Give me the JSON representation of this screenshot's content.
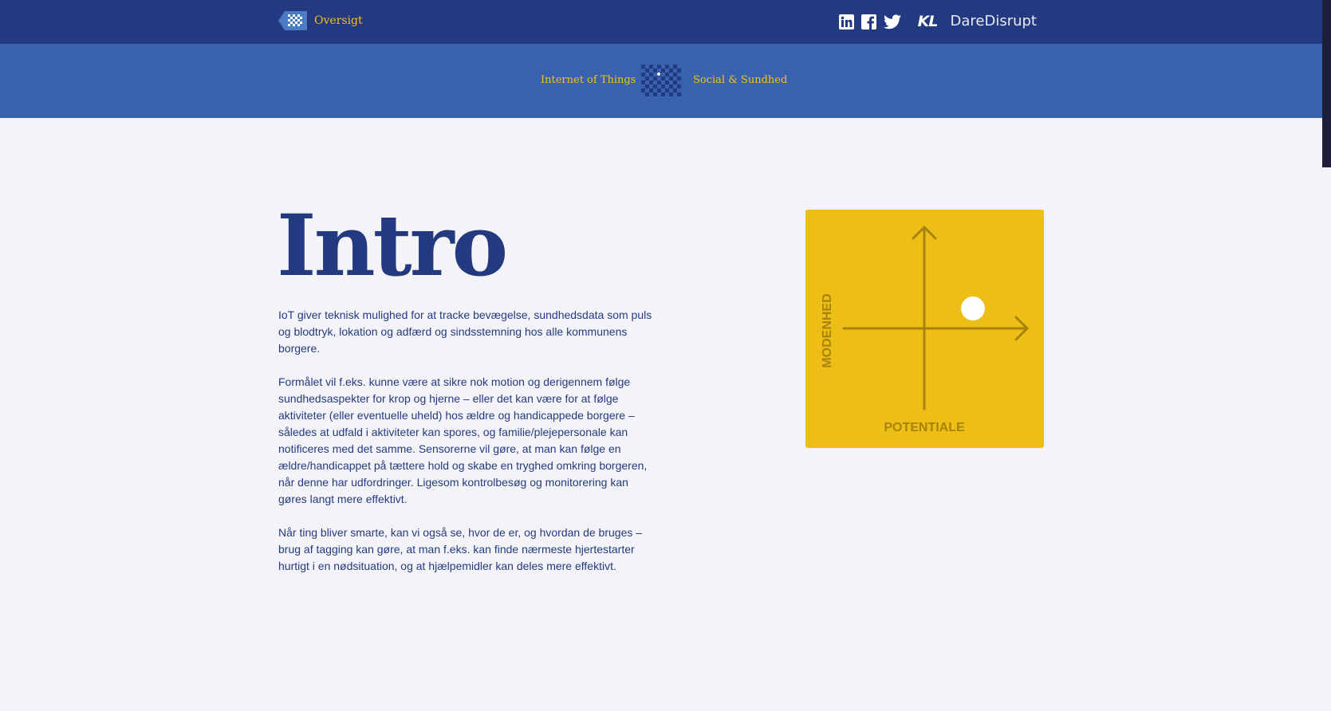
{
  "header": {
    "back_label": "Oversigt",
    "social_icons": [
      "linkedin-icon",
      "facebook-icon",
      "twitter-icon"
    ],
    "logos": {
      "kl": "KL",
      "daredisrupt": "DareDisrupt"
    }
  },
  "subnav": {
    "left_label": "Internet of Things",
    "right_label": "Social & Sundhed"
  },
  "main": {
    "title": "Intro",
    "paragraphs": [
      "IoT giver teknisk mulighed for at tracke bevægelse, sundhedsdata som puls og blodtryk, lokation og adfærd og sindsstemning hos alle kommunens borgere.",
      "Formålet vil f.eks. kunne være at sikre nok motion og derigennem følge sundhedsaspekter for krop og hjerne – eller det kan være for at følge aktiviteter (eller eventuelle uheld) hos ældre og handicappede borgere – således at udfald i aktiviteter kan spores, og familie/plejepersonale kan notificeres med det samme. Sensorerne vil gøre, at man kan følge en ældre/handicappet på tættere hold og skabe en tryghed omkring borgeren, når denne har udfordringer. Ligesom kontrolbesøg og monitorering kan gøres langt mere effektivt.",
      "Når ting bliver smarte, kan vi også se, hvor de er, og hvordan de bruges – brug af tagging kan gøre, at man f.eks. kan finde nærmeste hjertestarter hurtigt i en nødsituation, og at hjælpemidler kan deles mere effektivt."
    ]
  },
  "matrix": {
    "y_label": "MODENHED",
    "x_label": "POTENTIALE",
    "background": "#edbe16"
  },
  "colors": {
    "navy": "#233a80",
    "blue": "#3862ad",
    "yellow": "#f3c218"
  }
}
